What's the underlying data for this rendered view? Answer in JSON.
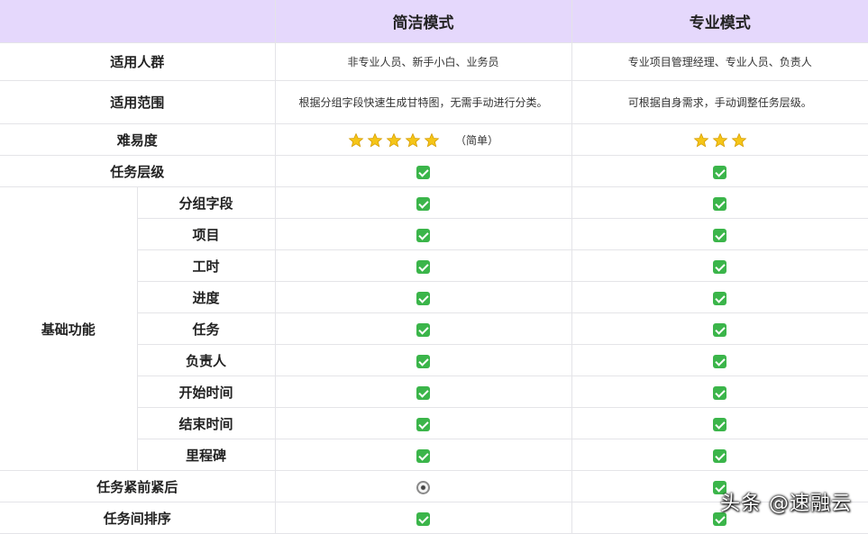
{
  "header": {
    "corner": "",
    "col_simple": "简洁模式",
    "col_pro": "专业模式"
  },
  "rows": {
    "audience": {
      "label": "适用人群",
      "simple": "非专业人员、新手小白、业务员",
      "pro": "专业项目管理经理、专业人员、负责人"
    },
    "scope": {
      "label": "适用范围",
      "simple": "根据分组字段快速生成甘特图，无需手动进行分类。",
      "pro": "可根据自身需求，手动调整任务层级。"
    },
    "difficulty": {
      "label": "难易度",
      "simple_stars": 5,
      "simple_note": "（简单）",
      "pro_stars": 3
    },
    "task_level": {
      "label": "任务层级",
      "simple": "check",
      "pro": "check"
    },
    "basic_group": {
      "label": "基础功能",
      "items": [
        {
          "label": "分组字段",
          "simple": "check",
          "pro": "check"
        },
        {
          "label": "项目",
          "simple": "check",
          "pro": "check"
        },
        {
          "label": "工时",
          "simple": "check",
          "pro": "check"
        },
        {
          "label": "进度",
          "simple": "check",
          "pro": "check"
        },
        {
          "label": "任务",
          "simple": "check",
          "pro": "check"
        },
        {
          "label": "负责人",
          "simple": "check",
          "pro": "check"
        },
        {
          "label": "开始时间",
          "simple": "check",
          "pro": "check"
        },
        {
          "label": "结束时间",
          "simple": "check",
          "pro": "check"
        },
        {
          "label": "里程碑",
          "simple": "check",
          "pro": "check"
        }
      ]
    },
    "task_dependency": {
      "label": "任务紧前紧后",
      "simple": "radio",
      "pro": "check"
    },
    "task_sort": {
      "label": "任务间排序",
      "simple": "check",
      "pro": "check"
    }
  },
  "watermark": "头条 @速融云",
  "colors": {
    "header_bg": "#e5d8fc",
    "check": "#3bb54a",
    "star": "#f5c518",
    "border": "#e4e4e8"
  },
  "icons": {
    "check": "check-mark-icon",
    "radio": "radio-button-icon",
    "star": "star-icon"
  }
}
